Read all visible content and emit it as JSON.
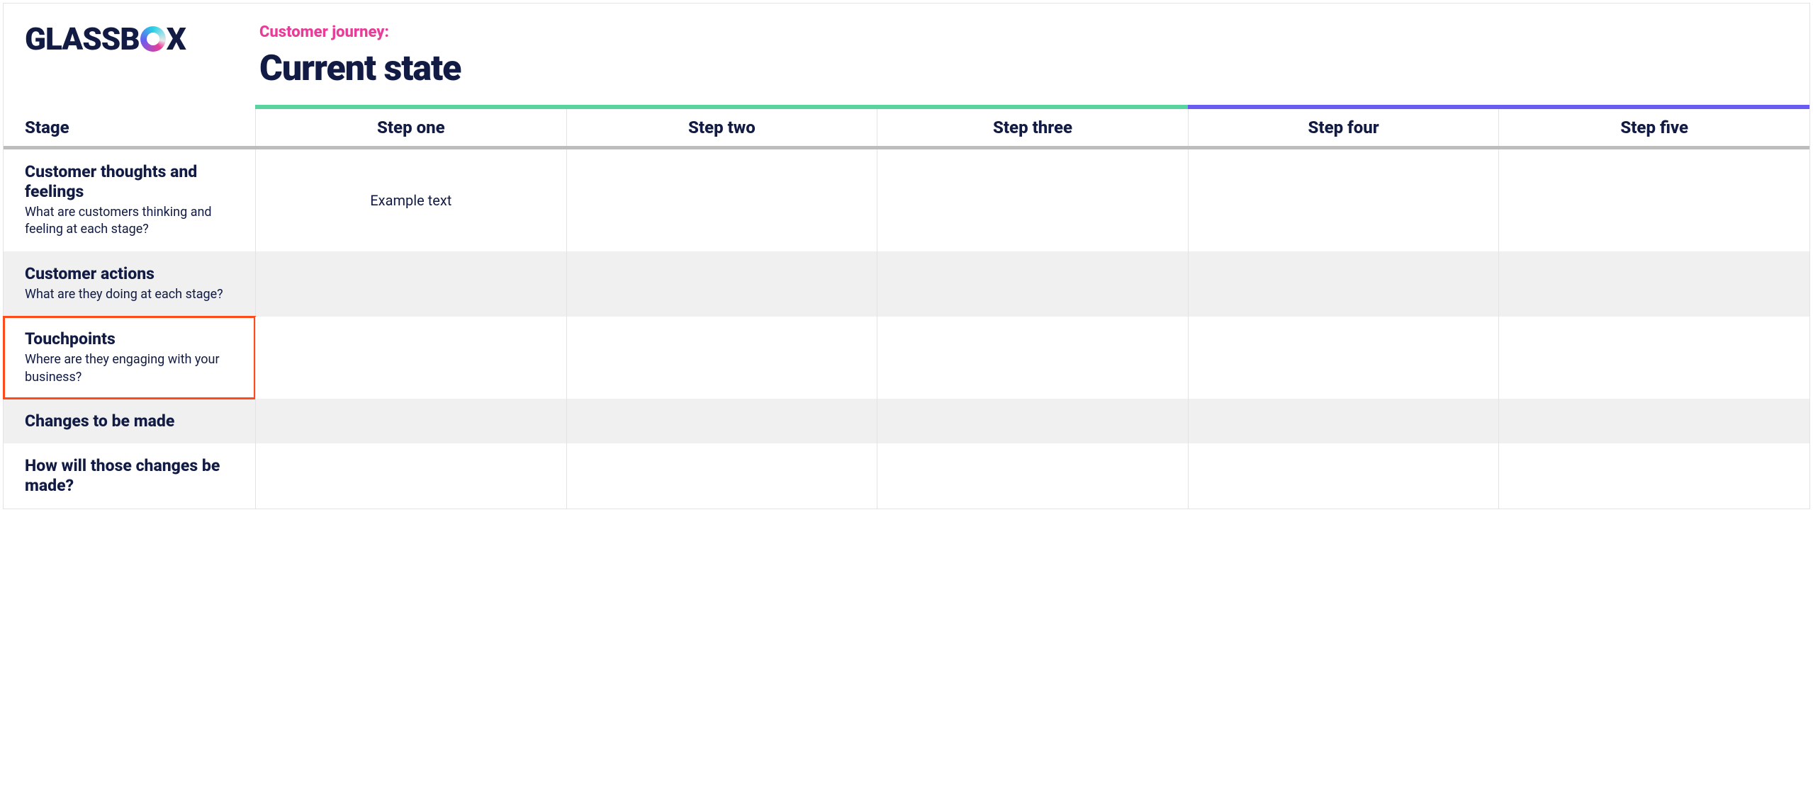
{
  "brand": {
    "name_part1": "GLASSB",
    "name_part2": "X"
  },
  "header": {
    "subtitle": "Customer journey:",
    "title": "Current state"
  },
  "colors": {
    "green": "#5AD49E",
    "violet": "#6A5CF0",
    "pink": "#E83C98",
    "navy": "#111B44"
  },
  "stage_label": "Stage",
  "steps": [
    "Step one",
    "Step two",
    "Step three",
    "Step four",
    "Step five"
  ],
  "step_bar_colors": [
    "green",
    "green",
    "green",
    "violet",
    "violet"
  ],
  "rows": [
    {
      "title": "Customer thoughts and feelings",
      "desc": "What are customers thinking and feeling at each stage?",
      "highlighted": false,
      "cells": [
        "Example text",
        "",
        "",
        "",
        ""
      ]
    },
    {
      "title": "Customer actions",
      "desc": "What are they doing at each stage?",
      "highlighted": false,
      "cells": [
        "",
        "",
        "",
        "",
        ""
      ]
    },
    {
      "title": "Touchpoints",
      "desc": "Where are they engaging with your business?",
      "highlighted": true,
      "cells": [
        "",
        "",
        "",
        "",
        ""
      ]
    },
    {
      "title": "Changes to be made",
      "desc": "",
      "highlighted": false,
      "cells": [
        "",
        "",
        "",
        "",
        ""
      ]
    },
    {
      "title": "How will those changes be made?",
      "desc": "",
      "highlighted": false,
      "cells": [
        "",
        "",
        "",
        "",
        ""
      ]
    }
  ]
}
